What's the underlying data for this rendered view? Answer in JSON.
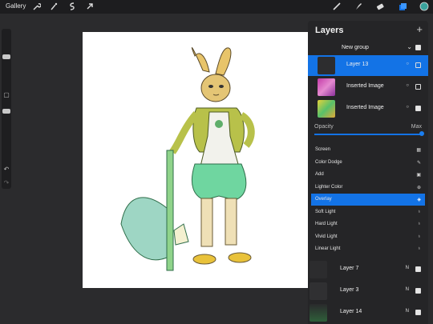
{
  "topbar": {
    "gallery_label": "Gallery",
    "tools": [
      {
        "icon": "wrench-icon"
      },
      {
        "icon": "magic-wand-icon"
      },
      {
        "icon": "selection-icon"
      },
      {
        "icon": "transform-arrow-icon"
      },
      {
        "icon": "brush-icon"
      },
      {
        "icon": "smudge-icon"
      },
      {
        "icon": "eraser-icon"
      },
      {
        "icon": "layers-icon"
      },
      {
        "icon": "color-swatch-icon"
      }
    ],
    "accent_color": "#1373e6"
  },
  "layers_panel": {
    "title": "Layers",
    "add_icon": "+",
    "group": {
      "name": "New group"
    },
    "top_layers": [
      {
        "name": "Layer 13",
        "selected": true,
        "visible": false
      },
      {
        "name": "Inserted Image",
        "selected": false,
        "visible": false
      },
      {
        "name": "Inserted Image",
        "selected": false,
        "visible": true
      }
    ],
    "opacity": {
      "label": "Opacity",
      "max_label": "Max",
      "value": 1.0
    },
    "blend_modes": [
      {
        "name": "Screen",
        "selected": false
      },
      {
        "name": "Color Dodge",
        "selected": false
      },
      {
        "name": "Add",
        "selected": false
      },
      {
        "name": "Lighter Color",
        "selected": false
      },
      {
        "name": "Overlay",
        "selected": true
      },
      {
        "name": "Soft Light",
        "selected": false
      },
      {
        "name": "Hard Light",
        "selected": false
      },
      {
        "name": "Vivid Light",
        "selected": false
      },
      {
        "name": "Linear Light",
        "selected": false
      }
    ],
    "bottom_layers": [
      {
        "name": "Layer 7",
        "mode": "N",
        "visible": true
      },
      {
        "name": "Layer 3",
        "mode": "N",
        "visible": true
      },
      {
        "name": "Layer 14",
        "mode": "N",
        "visible": true
      }
    ]
  }
}
